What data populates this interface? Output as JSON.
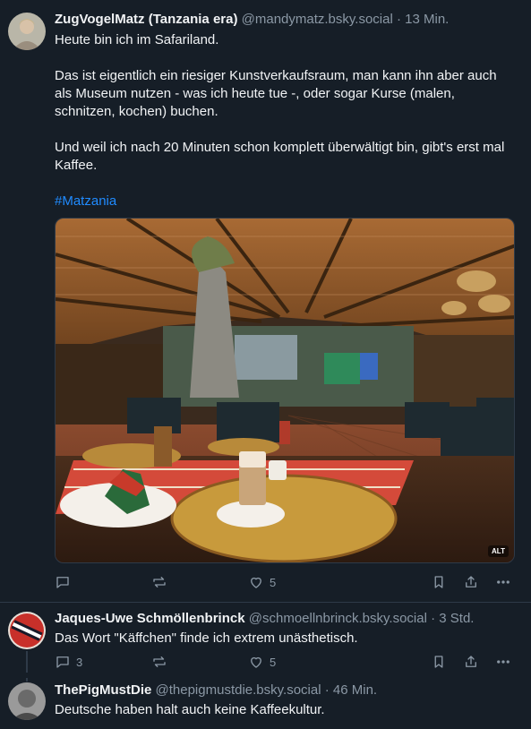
{
  "main_post": {
    "author": "ZugVogelMatz (Tanzania era)",
    "handle": "@mandymatz.bsky.social",
    "time": "· 13 Min.",
    "paragraphs": [
      "Heute bin ich im Safariland.",
      "Das ist eigentlich ein riesiger Kunstverkaufsraum, man kann ihn aber auch als Museum nutzen - was ich heute tue -, oder sogar Kurse (malen, schnitzen, kochen) buchen.",
      "Und weil ich nach 20 Minuten schon komplett überwältigt bin, gibt's erst mal Kaffee."
    ],
    "hashtag": "#Matzania",
    "image_alt_badge": "ALT",
    "like_count": "5"
  },
  "reply1": {
    "author": "Jaques-Uwe Schmöllenbrinck",
    "handle": "@schmoellnbrinck.bsky.social",
    "time": "· 3 Std.",
    "text": "Das Wort \"Käffchen\" finde ich extrem unästhetisch.",
    "reply_count": "3",
    "like_count": "5"
  },
  "reply2": {
    "author": "ThePigMustDie",
    "handle": "@thepigmustdie.bsky.social",
    "time": "· 46 Min.",
    "text": "Deutsche haben halt auch keine Kaffeekultur."
  },
  "colors": {
    "background": "#161e27",
    "text": "#f1f3f5",
    "muted": "#8b98a5",
    "link": "#208bfe",
    "divider": "#2e3a48"
  },
  "icons": [
    "reply-icon",
    "repost-icon",
    "like-icon",
    "bookmark-icon",
    "share-icon",
    "more-icon"
  ]
}
